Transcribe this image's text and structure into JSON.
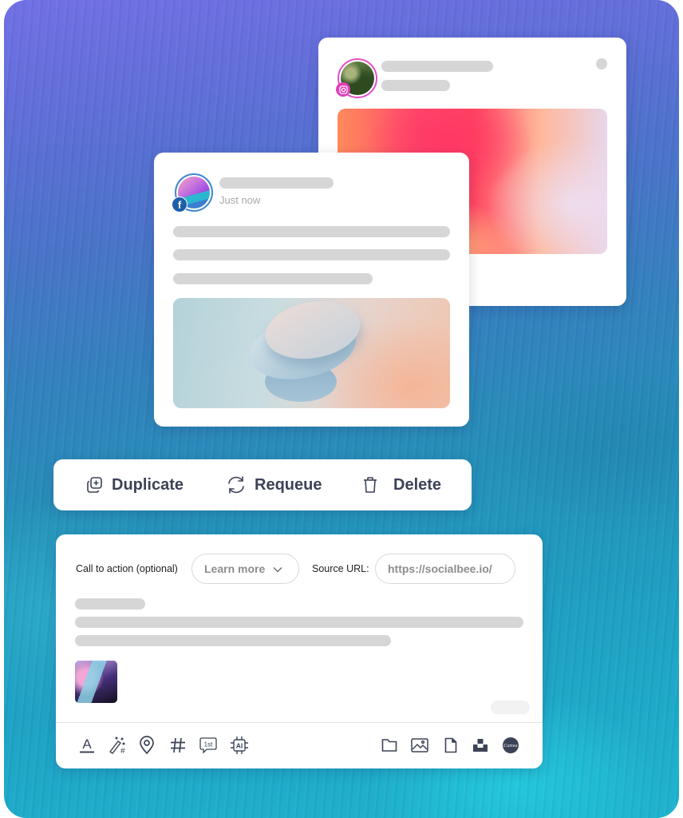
{
  "instagram_post": {
    "network": "instagram",
    "network_icon": "instagram-icon",
    "brand_color": "#e040b8"
  },
  "facebook_post": {
    "network": "facebook",
    "network_icon": "facebook-icon",
    "badge_glyph": "f",
    "timestamp": "Just now",
    "brand_color": "#1d5fa8"
  },
  "actions": {
    "duplicate": {
      "label": "Duplicate",
      "icon": "duplicate-icon"
    },
    "requeue": {
      "label": "Requeue",
      "icon": "requeue-icon"
    },
    "delete": {
      "label": "Delete",
      "icon": "trash-icon"
    },
    "text_color": "#3c4356"
  },
  "composer": {
    "cta_label": "Call to action (optional)",
    "cta_value": "Learn more",
    "source_url_label": "Source URL:",
    "source_url_value": "https://socialbee.io/",
    "toolbar_left": [
      {
        "name": "text-format-icon",
        "glyph": "A"
      },
      {
        "name": "hashtag-generator-icon"
      },
      {
        "name": "location-pin-icon"
      },
      {
        "name": "hashtag-icon",
        "glyph": "#"
      },
      {
        "name": "first-comment-icon",
        "glyph": "1st"
      },
      {
        "name": "ai-chip-icon",
        "glyph": "AI"
      }
    ],
    "toolbar_right": [
      {
        "name": "folder-icon"
      },
      {
        "name": "image-icon"
      },
      {
        "name": "file-icon"
      },
      {
        "name": "unsplash-icon"
      },
      {
        "name": "canva-icon",
        "glyph": "Canva"
      }
    ]
  }
}
